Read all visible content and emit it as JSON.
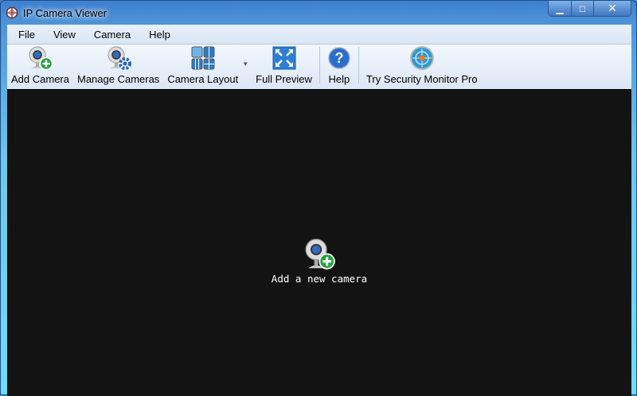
{
  "window": {
    "title": "IP Camera Viewer",
    "minimize": "▁",
    "maximize": "□",
    "close": "✕"
  },
  "menu": [
    "File",
    "View",
    "Camera",
    "Help"
  ],
  "toolbar": {
    "add_camera": "Add Camera",
    "manage_cameras": "Manage Cameras",
    "camera_layout": "Camera Layout",
    "full_preview": "Full Preview",
    "help": "Help",
    "try_pro": "Try Security Monitor Pro"
  },
  "main": {
    "add_new_camera": "Add a new camera"
  }
}
